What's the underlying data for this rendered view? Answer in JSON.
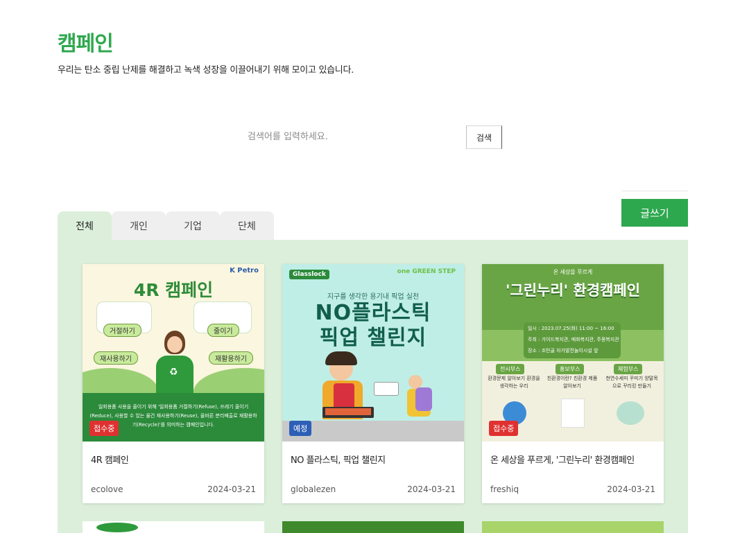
{
  "header": {
    "title": "캠페인",
    "description": "우리는 탄소 중립 난제를 해결하고 녹색 성장을 이끌어내기 위해 모이고 있습니다."
  },
  "search": {
    "placeholder": "검색어를 입력하세요.",
    "button_label": "검색"
  },
  "write_button": "글쓰기",
  "tabs": [
    {
      "label": "전체",
      "active": true
    },
    {
      "label": "개인",
      "active": false
    },
    {
      "label": "기업",
      "active": false
    },
    {
      "label": "단체",
      "active": false
    }
  ],
  "cards": [
    {
      "status": "접수중",
      "title": "4R 캠페인",
      "author": "ecolove",
      "date": "2024-03-21",
      "thumb": {
        "heading": "4R 캠페인",
        "brand": "K Petro",
        "labels": [
          "거절하기",
          "줄이기",
          "재사용하기",
          "재활용하기"
        ],
        "caption": "일회용품 사용을 줄이기 위해 '일회용품 거절하기(Refuse), 쓰레기 줄이기(Reduce), 사용할 수 있는 물건 재사용하기(Reuse), 올바른 분리배출로 재활용하기(Recycle)'를 의미하는 캠페인입니다."
      }
    },
    {
      "status": "예정",
      "title": "NO 플라스틱, 픽업 챌린지",
      "author": "globalezen",
      "date": "2024-03-21",
      "thumb": {
        "brand": "Glasslock",
        "brand2": "one GREEN STEP",
        "subtitle": "지구를 생각한 용기내 픽업 실천",
        "heading_line1": "NO플라스틱",
        "heading_line2": "픽업 챌린지"
      }
    },
    {
      "status": "접수중",
      "title": "온 세상을 푸르게, '그린누리' 환경캠페인",
      "author": "freshiq",
      "date": "2024-03-21",
      "thumb": {
        "top_text": "온 세상을 푸르게",
        "heading": "'그린누리' 환경캠페인",
        "info": [
          "일시 : 2023.07.25(화) 11:00 ~ 16:00",
          "주최 : 가이드복지관, 매화복지관, 주몽복지관",
          "장소 : 조탄골 자가발전놀이시설 앞"
        ],
        "booths": [
          "전시부스",
          "홍보부스",
          "체험부스"
        ],
        "booth_desc": [
          "환경문제 알아보기 환경을 생각하는 우리",
          "친환경이란? 친환경 제품 알아보기",
          "천연수세미 꾸미기 양말목으로 꾸리킹 만들기"
        ]
      }
    }
  ],
  "colors": {
    "accent": "#2ea84f",
    "board_bg": "#dcefdb",
    "badge_red": "#e03131",
    "badge_blue": "#2d5fb7"
  }
}
